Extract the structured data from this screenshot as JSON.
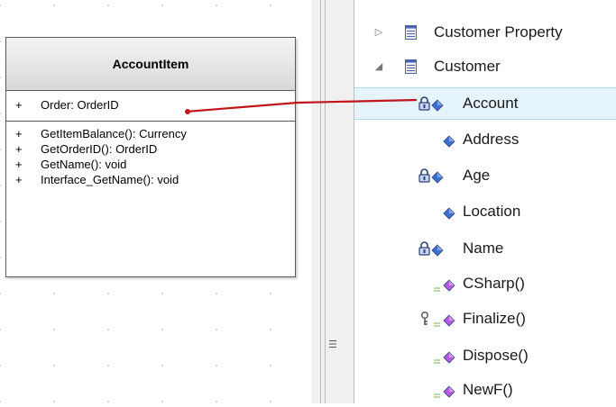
{
  "diagram": {
    "class_name": "AccountItem",
    "attributes": [
      {
        "visibility": "+",
        "text": "Order: OrderID"
      }
    ],
    "operations": [
      {
        "visibility": "+",
        "text": "GetItemBalance(): Currency"
      },
      {
        "visibility": "+",
        "text": "GetOrderID(): OrderID"
      },
      {
        "visibility": "+",
        "text": "GetName(): void"
      },
      {
        "visibility": "+",
        "text": "Interface_GetName(): void"
      }
    ],
    "connector_color": "#c0161c"
  },
  "splitter": {
    "grip_icon": "grip-lines-icon"
  },
  "tree": {
    "nodes": [
      {
        "label": "Customer Property",
        "expander": "▷",
        "icon": "table-icon"
      },
      {
        "label": "Customer",
        "expander": "◢",
        "icon": "table-icon"
      }
    ],
    "members": [
      {
        "label": "Account",
        "icon": "locked-attribute-icon",
        "selected": true
      },
      {
        "label": "Address",
        "icon": "attribute-icon"
      },
      {
        "label": "Age",
        "icon": "locked-attribute-icon"
      },
      {
        "label": "Location",
        "icon": "attribute-icon"
      },
      {
        "label": "Name",
        "icon": "locked-attribute-icon"
      },
      {
        "label": "CSharp()",
        "icon": "public-method-icon"
      },
      {
        "label": "Finalize()",
        "icon": "protected-method-icon"
      },
      {
        "label": "Dispose()",
        "icon": "public-method-icon"
      },
      {
        "label": "NewF()",
        "icon": "public-method-icon"
      }
    ],
    "colors": {
      "attribute": "#3d6fd1",
      "method": "#b65be0",
      "selection": "#e5f3fb"
    }
  }
}
